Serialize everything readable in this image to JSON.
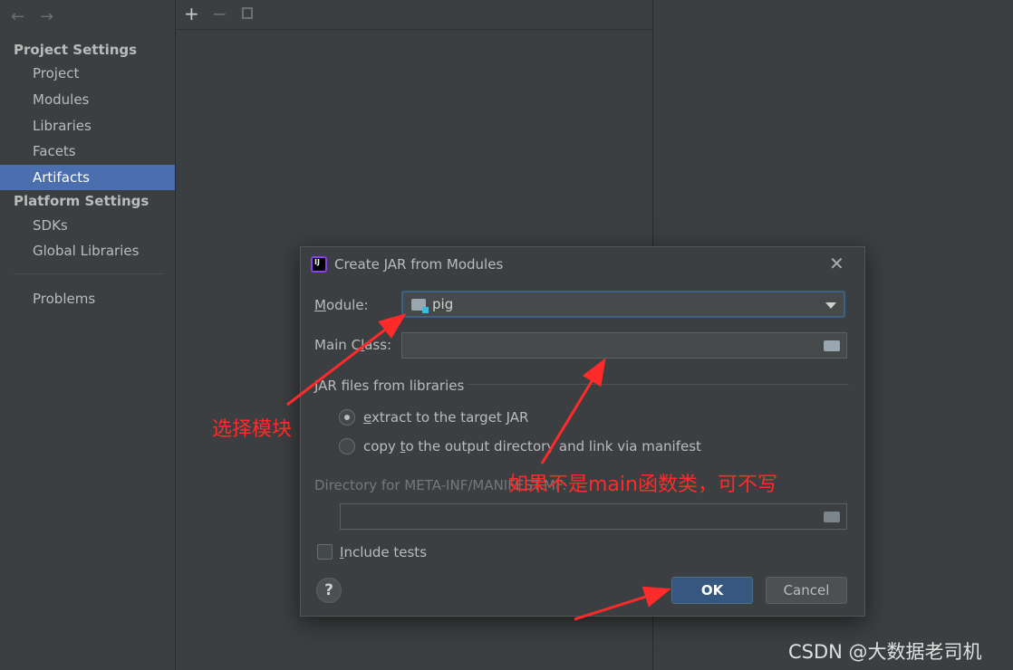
{
  "sidebar": {
    "back_icon": "arrow-left-icon",
    "forward_icon": "arrow-right-icon",
    "project_settings_title": "Project Settings",
    "project_items": [
      "Project",
      "Modules",
      "Libraries",
      "Facets",
      "Artifacts"
    ],
    "selected_item": "Artifacts",
    "platform_settings_title": "Platform Settings",
    "platform_items": [
      "SDKs",
      "Global Libraries"
    ],
    "problems": "Problems"
  },
  "toolbar": {
    "add": "+",
    "remove": "−",
    "copy_icon": "copy-icon"
  },
  "dialog": {
    "title": "Create JAR from Modules",
    "close": "✕",
    "module_label_first": "M",
    "module_label_rest": "odule:",
    "module_value": "pig",
    "main_class_label_pre": "Main C",
    "main_class_label_u": "l",
    "main_class_label_post": "ass:",
    "main_class_value": "",
    "jar_files_title": "JAR files from libraries",
    "option_extract_u": "e",
    "option_extract_rest": "xtract to the target JAR",
    "option_copy_pre": "copy ",
    "option_copy_u": "t",
    "option_copy_rest": "o the output directory and link via manifest",
    "selected_option": "extract",
    "directory_label": "Directory for META-INF/MANIFEST.MF:",
    "directory_value": "",
    "include_tests_u": "I",
    "include_tests_rest": "nclude tests",
    "include_tests_checked": false,
    "help": "?",
    "ok": "OK",
    "cancel": "Cancel"
  },
  "annotations": {
    "select_module": "选择模块",
    "main_class_note": "如果不是main函数类，可不写",
    "color": "#ff2a2a"
  },
  "watermark": "CSDN @大数据老司机"
}
